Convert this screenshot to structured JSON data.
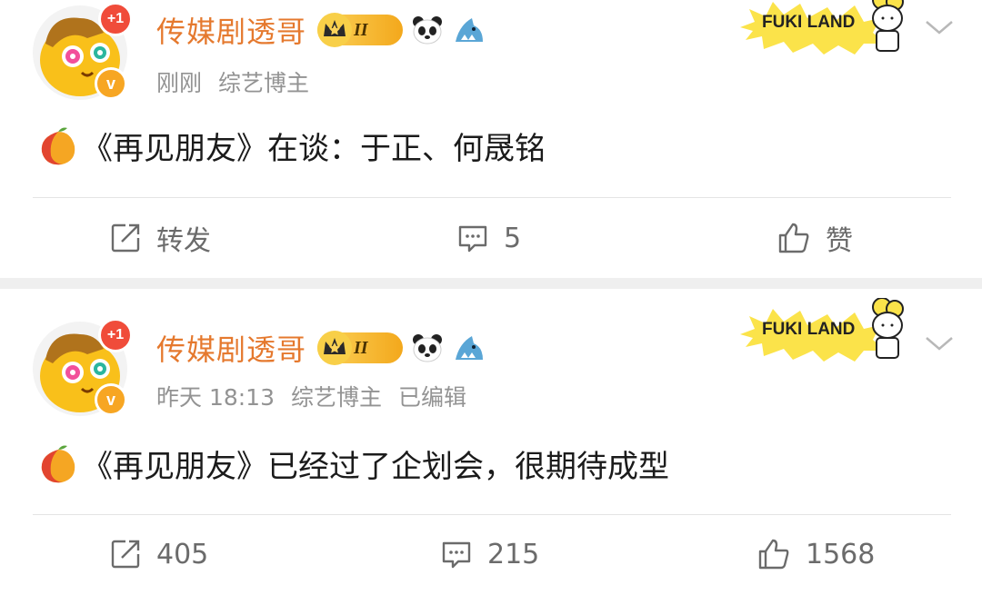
{
  "posts": [
    {
      "username": "传媒剧透哥",
      "badge_level": "II",
      "avatar_notification": "+1",
      "verified_mark": "v",
      "time": "刚刚",
      "category": "综艺博主",
      "edited": "",
      "card_text": "FUKI LAND",
      "content": "《再见朋友》在谈：于正、何晟铭",
      "actions": {
        "repost": "转发",
        "comment": "5",
        "like": "赞"
      }
    },
    {
      "username": "传媒剧透哥",
      "badge_level": "II",
      "avatar_notification": "+1",
      "verified_mark": "v",
      "time": "昨天 18:13",
      "category": "综艺博主",
      "edited": "已编辑",
      "card_text": "FUKI LAND",
      "content": "《再见朋友》已经过了企划会，很期待成型",
      "actions": {
        "repost": "405",
        "comment": "215",
        "like": "1568"
      }
    }
  ],
  "colors": {
    "username": "#e5792e",
    "meta": "#939393",
    "content": "#1b1b1b",
    "action": "#6b6b6b",
    "badge_red": "#f04c3a",
    "badge_orange": "#f7a623",
    "divider_gap": "#efefef"
  },
  "icons": [
    "mango-emoji-icon",
    "crown-badge-icon",
    "panda-icon",
    "shark-icon",
    "chevron-down-icon",
    "repost-icon",
    "comment-icon",
    "like-icon"
  ]
}
